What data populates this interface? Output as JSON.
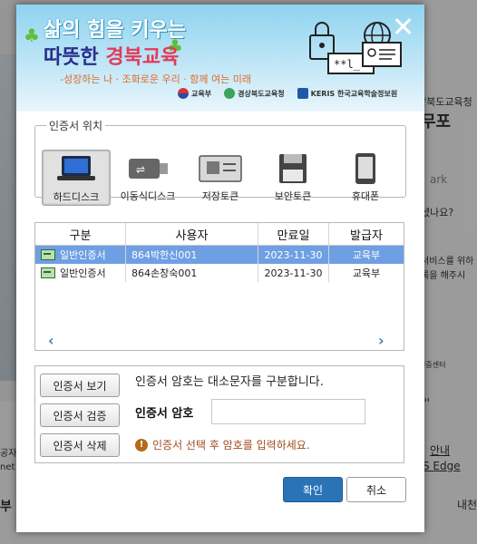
{
  "background": {
    "right_texts": [
      "상북도교육청",
      "무포",
      "ark",
      "셨나요?",
      "서비스를 위하",
      "록을 해주시",
      "인증센터",
      "원"
    ],
    "footer_texts": [
      "공자",
      "net",
      "부",
      "안내",
      "S Edge",
      "내천"
    ]
  },
  "banner": {
    "line1": "삶의 힘을 키우는",
    "line2_a": "따뜻한 ",
    "line2_b": "경북교육",
    "line3": "-성장하는 나 · 조화로운 우리 · 함께 여는 미래",
    "logos": [
      "교육부",
      "경상북도교육청",
      "KERIS 한국교육학술정보원"
    ],
    "password_art": "**l_"
  },
  "location": {
    "legend": "인증서 위치",
    "drives": [
      {
        "label": "하드디스크",
        "icon": "laptop-icon",
        "selected": true
      },
      {
        "label": "이동식디스크",
        "icon": "usb-icon",
        "selected": false
      },
      {
        "label": "저장토큰",
        "icon": "token-icon",
        "selected": false
      },
      {
        "label": "보안토큰",
        "icon": "floppy-icon",
        "selected": false
      },
      {
        "label": "휴대폰",
        "icon": "phone-icon",
        "selected": false
      }
    ]
  },
  "table": {
    "headers": [
      "구분",
      "사용자",
      "만료일",
      "발급자"
    ],
    "rows": [
      {
        "type": "일반인증서",
        "user": "864박한신001",
        "expiry": "2023-11-30",
        "issuer": "교육부",
        "selected": true
      },
      {
        "type": "일반인증서",
        "user": "864손창숙001",
        "expiry": "2023-11-30",
        "issuer": "교육부",
        "selected": false
      }
    ],
    "scroll_left": "‹",
    "scroll_right": "›"
  },
  "password": {
    "view_button": "인증서 보기",
    "verify_button": "인증서 검증",
    "delete_button": "인증서 삭제",
    "note": "인증서 암호는 대소문자를 구분합니다.",
    "label": "인증서 암호",
    "value": "",
    "warning_icon": "!",
    "warning": "인증서 선택 후 암호를 입력하세요."
  },
  "footer_buttons": {
    "ok": "확인",
    "cancel": "취소"
  },
  "colors": {
    "primary": "#2a73b5",
    "selection": "#6f9fe3",
    "warning": "#a04a1a"
  }
}
